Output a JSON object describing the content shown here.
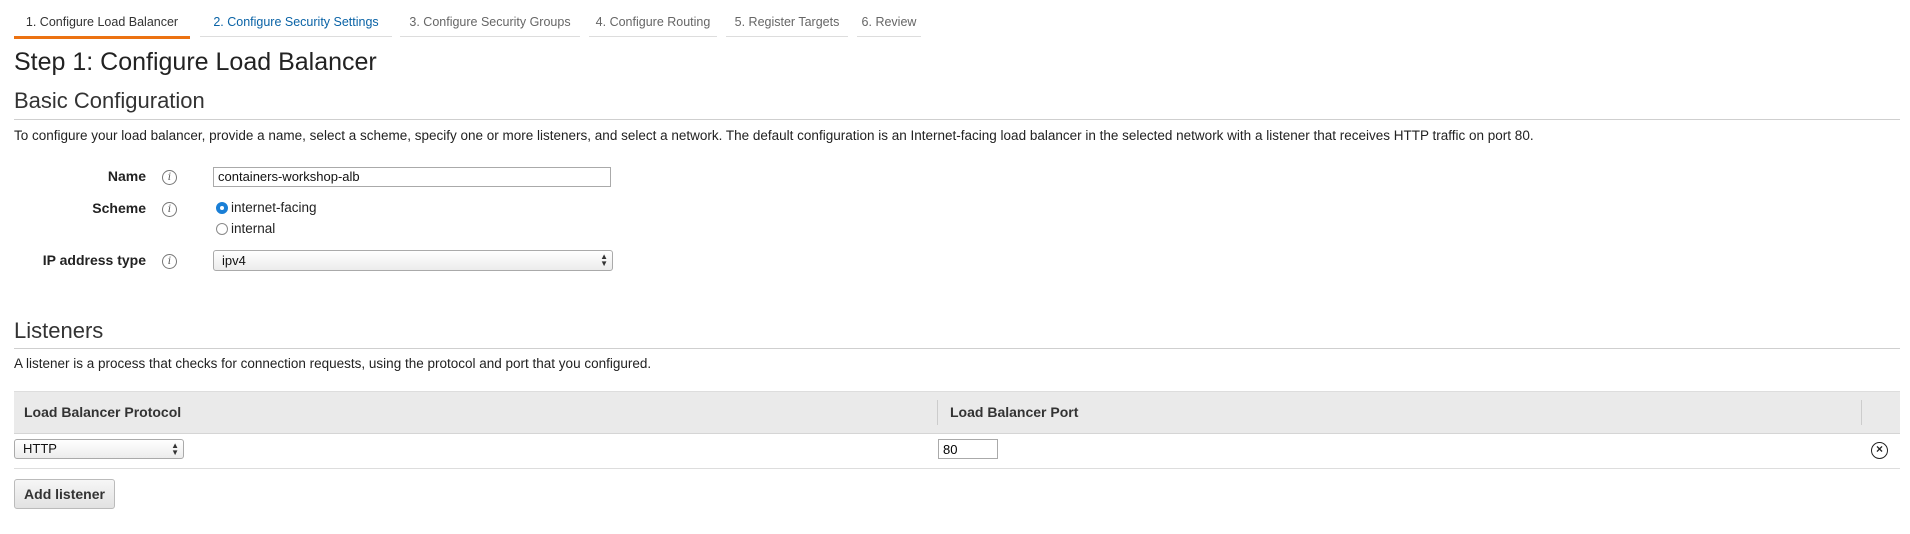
{
  "wizard": {
    "tabs": [
      {
        "label": "1. Configure Load Balancer",
        "active": true
      },
      {
        "label": "2. Configure Security Settings",
        "active": false
      },
      {
        "label": "3. Configure Security Groups",
        "active": false
      },
      {
        "label": "4. Configure Routing",
        "active": false
      },
      {
        "label": "5. Register Targets",
        "active": false
      },
      {
        "label": "6. Review",
        "active": false
      }
    ]
  },
  "step_title": "Step 1: Configure Load Balancer",
  "basic": {
    "title": "Basic Configuration",
    "description": "To configure your load balancer, provide a name, select a scheme, specify one or more listeners, and select a network. The default configuration is an Internet-facing load balancer in the selected network with a listener that receives HTTP traffic on port 80.",
    "name_label": "Name",
    "name_value": "containers-workshop-alb",
    "scheme_label": "Scheme",
    "scheme_options": [
      "internet-facing",
      "internal"
    ],
    "scheme_selected": "internet-facing",
    "ip_label": "IP address type",
    "ip_value": "ipv4",
    "info_glyph": "i"
  },
  "listeners": {
    "title": "Listeners",
    "description": "A listener is a process that checks for connection requests, using the protocol and port that you configured.",
    "columns": [
      "Load Balancer Protocol",
      "Load Balancer Port"
    ],
    "rows": [
      {
        "protocol": "HTTP",
        "port": "80"
      }
    ],
    "add_button": "Add listener"
  },
  "icons": {
    "info": "info-icon",
    "remove": "remove-circle-icon",
    "select_arrows": "select-arrows-icon"
  },
  "colors": {
    "active_tab": "#ec7211",
    "link": "#0a63a6",
    "radio_selected": "#1a7fd6"
  }
}
